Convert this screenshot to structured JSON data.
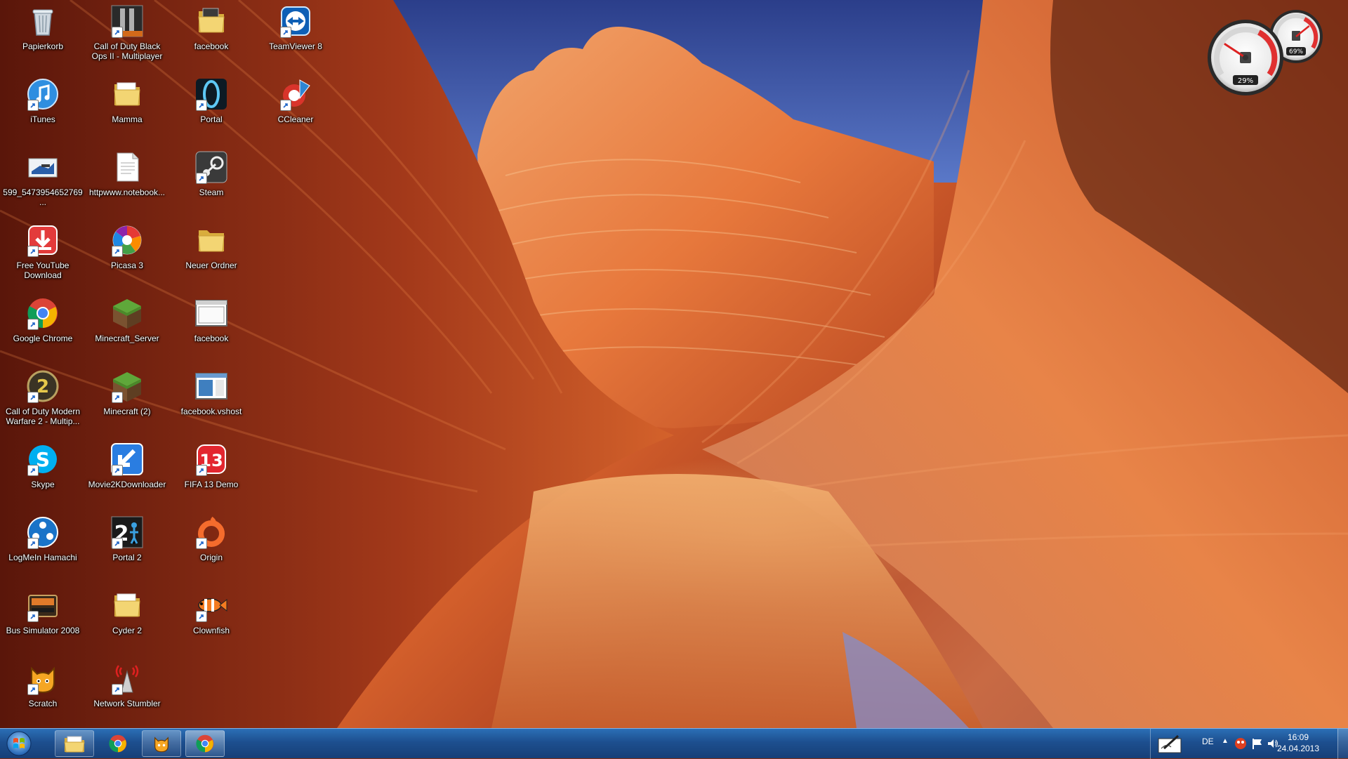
{
  "desktop": {
    "icons": [
      {
        "label": "Papierkorb",
        "icon": "recycle-bin-icon",
        "shortcut": false
      },
      {
        "label": "iTunes",
        "icon": "itunes-icon",
        "shortcut": true
      },
      {
        "label": "599_5473954652769...",
        "icon": "image-file-icon",
        "shortcut": false
      },
      {
        "label": "Free YouTube Download",
        "icon": "download-icon",
        "shortcut": true
      },
      {
        "label": "Google Chrome",
        "icon": "chrome-icon",
        "shortcut": true
      },
      {
        "label": "Call of Duty Modern Warfare 2 - Multip...",
        "icon": "cod-mw2-icon",
        "shortcut": true
      },
      {
        "label": "Skype",
        "icon": "skype-icon",
        "shortcut": true
      },
      {
        "label": "LogMeIn Hamachi",
        "icon": "hamachi-icon",
        "shortcut": true
      },
      {
        "label": "Bus Simulator 2008",
        "icon": "bus-icon",
        "shortcut": true
      },
      {
        "label": "Scratch",
        "icon": "scratch-cat-icon",
        "shortcut": true
      },
      {
        "label": "Call of Duty Black Ops II - Multiplayer",
        "icon": "cod-bo2-icon",
        "shortcut": true
      },
      {
        "label": "Mamma",
        "icon": "folder-icon",
        "shortcut": false
      },
      {
        "label": "httpwww.notebook...",
        "icon": "text-file-icon",
        "shortcut": false
      },
      {
        "label": "Picasa 3",
        "icon": "picasa-icon",
        "shortcut": true
      },
      {
        "label": "Minecraft_Server",
        "icon": "minecraft-block-icon",
        "shortcut": false
      },
      {
        "label": "Minecraft (2)",
        "icon": "minecraft-block-icon",
        "shortcut": true
      },
      {
        "label": "Movie2KDownloader",
        "icon": "arrow-download-icon",
        "shortcut": true
      },
      {
        "label": "Portal 2",
        "icon": "portal2-icon",
        "shortcut": true
      },
      {
        "label": "Cyder 2",
        "icon": "folder-icon",
        "shortcut": false
      },
      {
        "label": "Network Stumbler",
        "icon": "antenna-icon",
        "shortcut": true
      },
      {
        "label": "facebook",
        "icon": "folder-icon",
        "shortcut": false
      },
      {
        "label": "Portal",
        "icon": "portal-icon",
        "shortcut": true
      },
      {
        "label": "Steam",
        "icon": "steam-icon",
        "shortcut": true
      },
      {
        "label": "Neuer Ordner",
        "icon": "folder-icon",
        "shortcut": false
      },
      {
        "label": "facebook",
        "icon": "window-app-icon",
        "shortcut": false
      },
      {
        "label": "facebook.vshost",
        "icon": "window-app-icon",
        "shortcut": false
      },
      {
        "label": "FIFA 13 Demo",
        "icon": "fifa-icon",
        "shortcut": true
      },
      {
        "label": "Origin",
        "icon": "origin-icon",
        "shortcut": true
      },
      {
        "label": "Clownfish",
        "icon": "clownfish-icon",
        "shortcut": true
      },
      {
        "label": "TeamViewer 8",
        "icon": "teamviewer-icon",
        "shortcut": true
      },
      {
        "label": "CCleaner",
        "icon": "ccleaner-icon",
        "shortcut": true
      }
    ]
  },
  "gadget": {
    "name": "cpu-meter",
    "cpu_value": "29%",
    "memory_value": "69%",
    "cpu_fraction": 0.29,
    "memory_fraction": 0.69
  },
  "taskbar": {
    "start_icon": "windows-orb-icon",
    "buttons": [
      {
        "icon": "explorer-icon",
        "name": "taskbar-explorer",
        "state": "pinned"
      },
      {
        "icon": "chrome-icon",
        "name": "taskbar-chrome",
        "state": "plain"
      },
      {
        "icon": "scratch-cat-icon",
        "name": "taskbar-scratch",
        "state": "pinned"
      },
      {
        "icon": "chrome-icon",
        "name": "taskbar-chrome-active",
        "state": "active"
      }
    ]
  },
  "tray": {
    "language": "DE",
    "time": "16:09",
    "date": "24.04.2013"
  },
  "colors": {
    "taskbar": "#1d4f8f",
    "folder": "#e8c35a",
    "chrome_red": "#db4437",
    "chrome_green": "#0f9d58",
    "chrome_yellow": "#f4b400",
    "chrome_blue": "#4285f4"
  }
}
